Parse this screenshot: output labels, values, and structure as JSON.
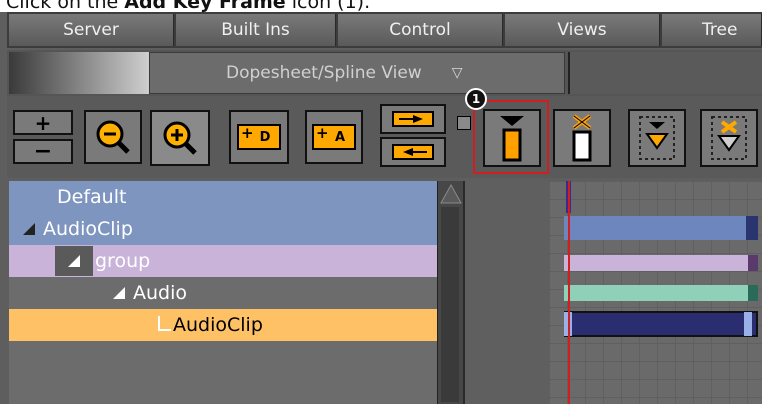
{
  "caption": {
    "prefix": "Click on the ",
    "bold": "Add Key Frame",
    "suffix": " icon (1)."
  },
  "menubar": {
    "items": [
      "Server",
      "Built Ins",
      "Control",
      "Views",
      "Tree"
    ]
  },
  "view_selector": {
    "value": "Dopesheet/Spline View",
    "chevron": "▽"
  },
  "toolbar": {
    "zoom_plus": "+",
    "zoom_minus": "−",
    "add_d": "D",
    "add_a": "A",
    "callout": "1",
    "highlighted_button": "add-key-frame-button"
  },
  "tree": {
    "rows": [
      {
        "label": "Default",
        "bg": "#7e95bf"
      },
      {
        "label": "AudioClip",
        "bg": "#7e95bf"
      },
      {
        "label": "group",
        "bg": "#c9b3d9"
      },
      {
        "label": "Audio",
        "bg": "#6c6c6c"
      },
      {
        "label": "AudioClip",
        "bg": "#ffc166"
      }
    ]
  },
  "colors": {
    "accent_highlight": "#d21e1e",
    "key_orange": "#ff9f00"
  }
}
